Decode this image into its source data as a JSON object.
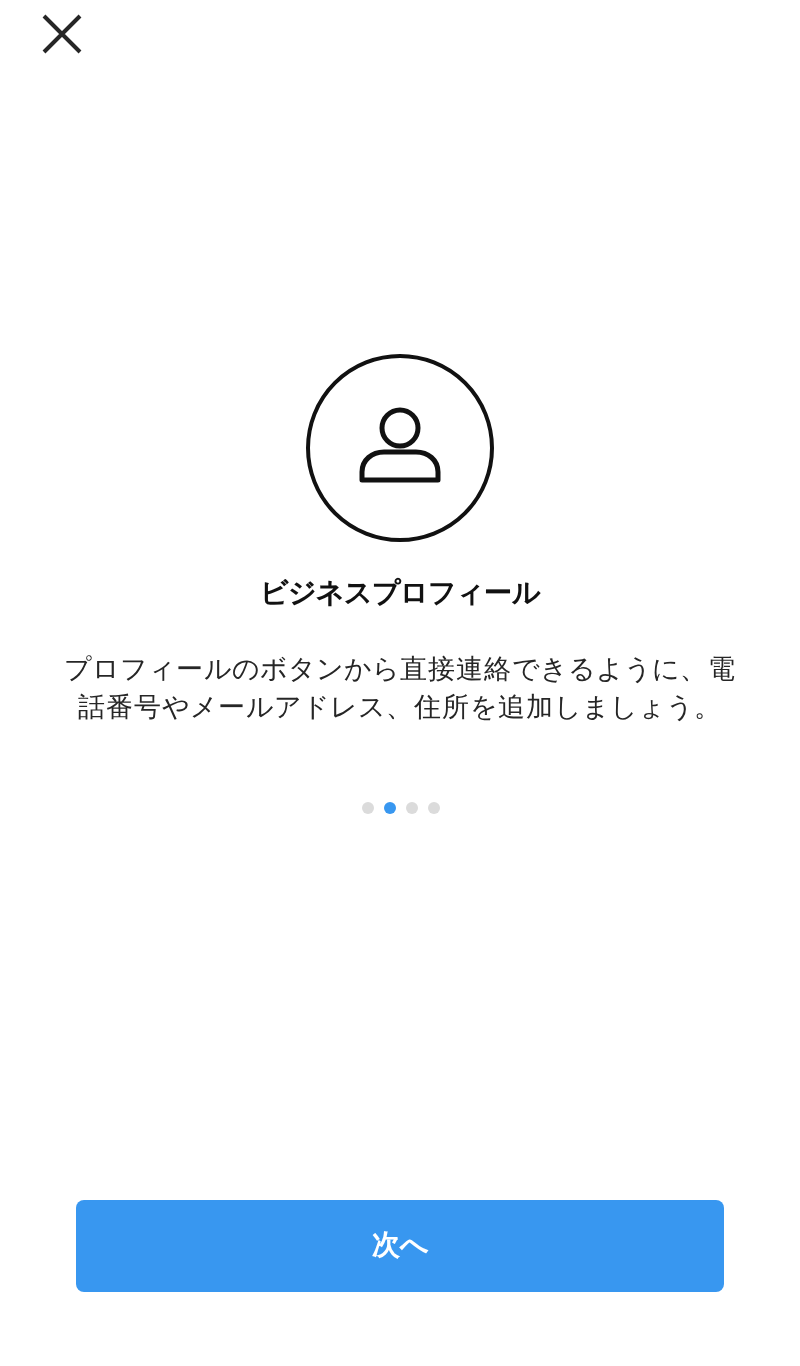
{
  "header": {
    "close_icon": true
  },
  "feature": {
    "title": "ビジネスプロフィール",
    "description": "プロフィールのボタンから直接連絡できるように、電話番号やメールアドレス、住所を追加しましょう。"
  },
  "pager": [
    {
      "selected": false
    },
    {
      "selected": true
    },
    {
      "selected": false
    },
    {
      "selected": false
    }
  ],
  "buttons": [
    {
      "label": "次へ"
    }
  ]
}
